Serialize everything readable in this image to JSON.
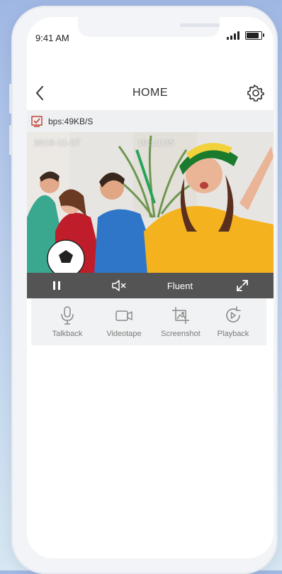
{
  "status_bar": {
    "time": "9:41 AM"
  },
  "header": {
    "title": "HOME"
  },
  "stream": {
    "bps": "bps:49KB/S"
  },
  "video": {
    "timestamp_date": "2019-11-27",
    "timestamp_time": "19:13:25"
  },
  "controls": {
    "quality_label": "Fluent"
  },
  "actions": [
    {
      "label": "Talkback",
      "icon": "microphone-icon"
    },
    {
      "label": "Videotape",
      "icon": "video-camera-icon"
    },
    {
      "label": "Screenshot",
      "icon": "crop-icon"
    },
    {
      "label": "Playback",
      "icon": "playback-icon"
    }
  ],
  "colors": {
    "control_bar": "#545454",
    "accent_check": "#c0392b",
    "background": "#b8cceb"
  }
}
